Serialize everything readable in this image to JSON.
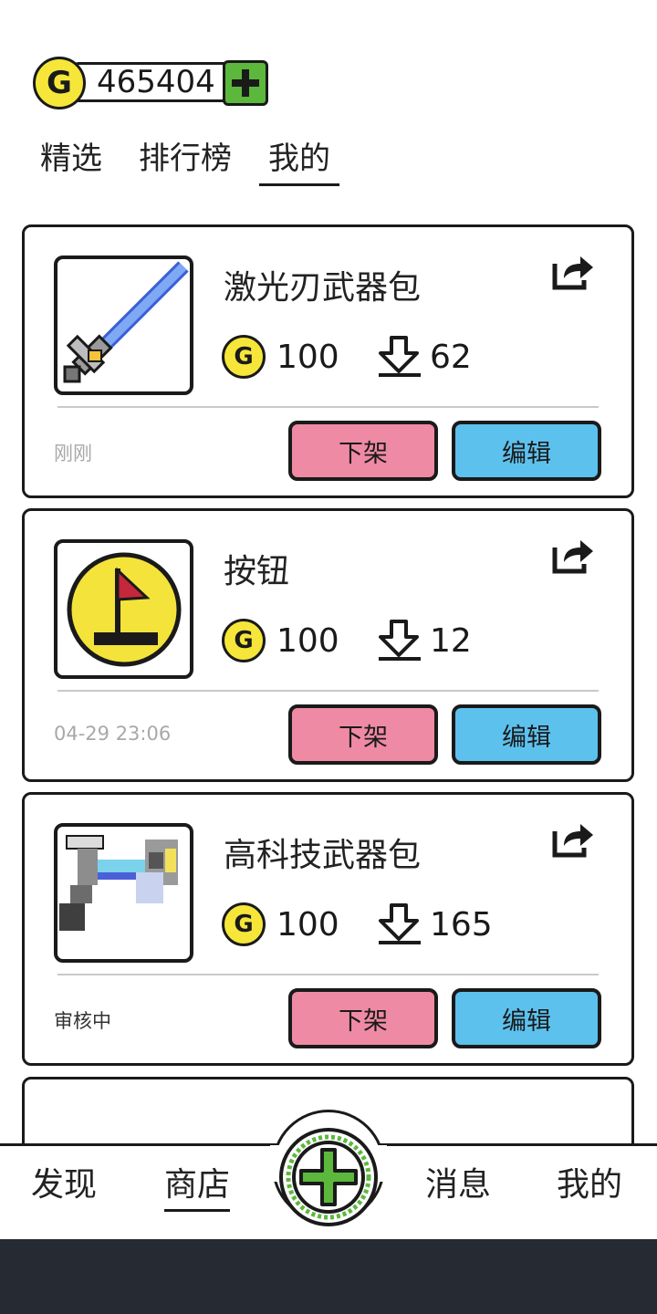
{
  "wallet": {
    "coin_symbol": "G",
    "balance": "465404",
    "add_icon": "plus-icon"
  },
  "tabs": [
    {
      "label": "精选",
      "active": false
    },
    {
      "label": "排行榜",
      "active": false
    },
    {
      "label": "我的",
      "active": true
    }
  ],
  "items": [
    {
      "title": "激光刃武器包",
      "coin_symbol": "G",
      "price": "100",
      "downloads": "62",
      "status": "刚刚",
      "unlist_label": "下架",
      "edit_label": "编辑",
      "thumbnail": "laser-sword-icon"
    },
    {
      "title": "按钮",
      "coin_symbol": "G",
      "price": "100",
      "downloads": "12",
      "status": "04-29 23:06",
      "unlist_label": "下架",
      "edit_label": "编辑",
      "thumbnail": "flag-button-icon"
    },
    {
      "title": "高科技武器包",
      "coin_symbol": "G",
      "price": "100",
      "downloads": "165",
      "status": "审核中",
      "unlist_label": "下架",
      "edit_label": "编辑",
      "thumbnail": "tech-gun-icon"
    }
  ],
  "bottom_nav": [
    {
      "label": "发现",
      "active": false
    },
    {
      "label": "商店",
      "active": true
    },
    {
      "label": "消息",
      "active": false
    },
    {
      "label": "我的",
      "active": false
    }
  ],
  "colors": {
    "coin_yellow": "#f6e63a",
    "add_green": "#5cb83c",
    "unlist_pink": "#ef8aa4",
    "edit_blue": "#5dc1ee",
    "outline": "#1a1a1a",
    "system_bar": "#262a33"
  }
}
